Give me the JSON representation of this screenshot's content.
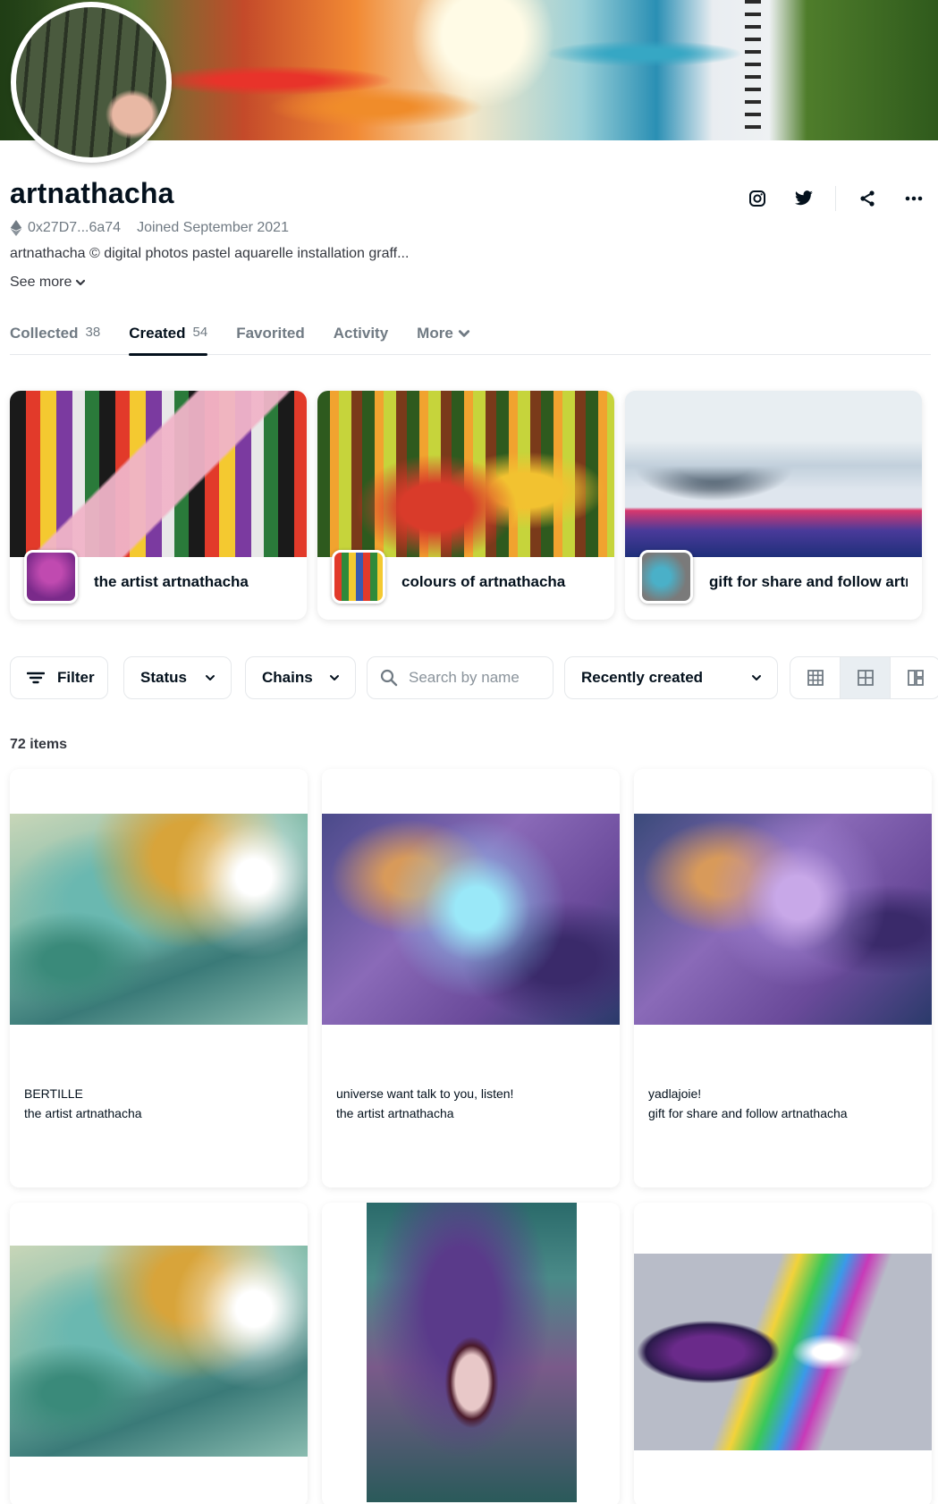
{
  "profile": {
    "name": "artnathacha",
    "address": "0x27D7...6a74",
    "joined": "Joined September 2021",
    "bio": "artnathacha © digital photos pastel aquarelle installation graff...",
    "see_more": "See more"
  },
  "actions": {
    "icons": [
      "instagram-icon",
      "twitter-icon",
      "share-icon",
      "more-icon"
    ]
  },
  "tabs": [
    {
      "label": "Collected",
      "count": "38"
    },
    {
      "label": "Created",
      "count": "54"
    },
    {
      "label": "Favorited",
      "count": ""
    },
    {
      "label": "Activity",
      "count": ""
    },
    {
      "label": "More",
      "count": ""
    }
  ],
  "collections": [
    {
      "name": "the artist artnathacha"
    },
    {
      "name": "colours of artnathacha"
    },
    {
      "name": "gift for share and follow artnathacha"
    }
  ],
  "toolbar": {
    "filter_label": "Filter",
    "status_label": "Status",
    "chains_label": "Chains",
    "search_placeholder": "Search by name",
    "sort_label": "Recently created"
  },
  "items_count": "72 items",
  "items": [
    {
      "title": "BERTILLE",
      "collection": "the artist artnathacha"
    },
    {
      "title": "universe want talk to you, listen!",
      "collection": "the artist artnathacha"
    },
    {
      "title": "yadlajoie!",
      "collection": "gift for share and follow artnathacha"
    },
    {
      "title": "",
      "collection": ""
    },
    {
      "title": "",
      "collection": ""
    },
    {
      "title": "",
      "collection": ""
    }
  ],
  "colors": {
    "text_primary": "#04111d",
    "text_secondary": "#707a83",
    "border": "#e5e8eb",
    "active_view_bg": "#e9eef2"
  }
}
